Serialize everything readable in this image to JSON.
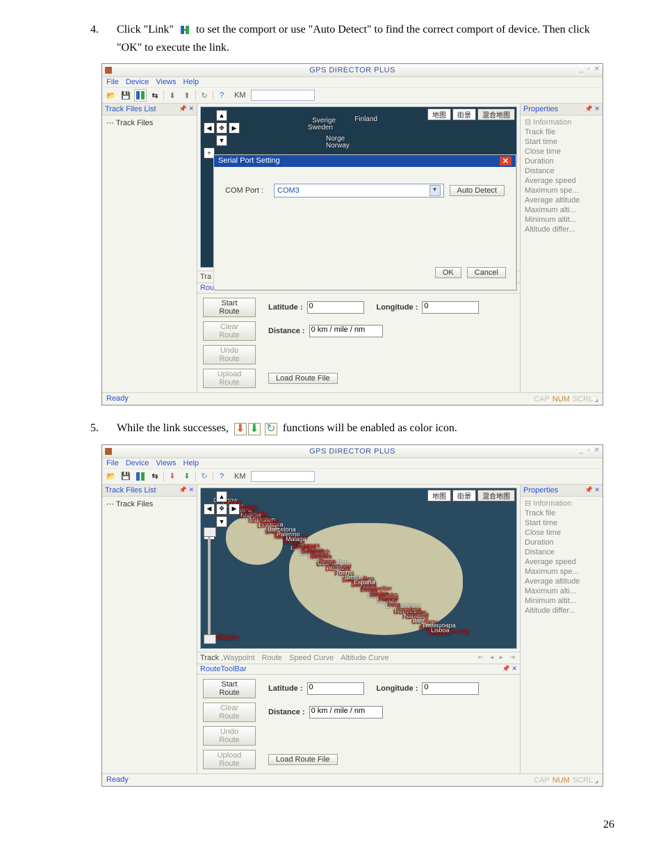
{
  "steps": {
    "s4_num": "4.",
    "s4_text_a": "Click \"Link\"",
    "s4_text_b": "to set the comport or use \"Auto Detect\" to find the correct comport of device. Then click \"OK\" to execute the link.",
    "s5_num": "5.",
    "s5_text_a": "While the link successes,",
    "s5_text_b": "functions will be enabled as color icon."
  },
  "app_title": "GPS DIRECTOR PLUS",
  "menu": [
    "File",
    "Device",
    "Views",
    "Help"
  ],
  "toolbar_unit": "KM",
  "left_panel_title": "Track Files List",
  "tree_root": "Track Files",
  "properties_title": "Properties",
  "prop_section": "Information",
  "props": [
    "Track file",
    "Start time",
    "Close time",
    "Duration",
    "Distance",
    "Average speed",
    "Maximum spe...",
    "Average altitude",
    "Maximum alti...",
    "Minimum altit...",
    "Altitude differ..."
  ],
  "map_tabs": [
    "地图",
    "街景",
    "混合地图"
  ],
  "map1_labels": {
    "norge": "Norge",
    "norway": "Norway",
    "sverige": "Sverige",
    "sweden": "Sweden",
    "finland": "Finland"
  },
  "dialog": {
    "title": "Serial Port Setting",
    "comport": "COM Port :",
    "comport_value": "COM3",
    "autodetect": "Auto Detect",
    "ok": "OK",
    "cancel": "Cancel"
  },
  "tabs2": {
    "track": "Track",
    "wp": ",Waypoint",
    "route": "Route",
    "speed": "Speed Curve",
    "alt": "Altitude Curve",
    "prefix": "Tra",
    "line2": "Rou"
  },
  "route_toolbar": "RouteToolBar",
  "route": {
    "start": "Start Route",
    "clear": "Clear Route",
    "undo": "Undo Route",
    "upload": "Upload Route",
    "load": "Load Route File",
    "lat": "Latitude :",
    "lon": "Longitude :",
    "dist": "Distance :",
    "zero": "0",
    "dvalue": "0 km / mile / nm"
  },
  "status": {
    "ready": "Ready",
    "cap": "CAP",
    "num": "NUM",
    "scrl": "SCRL"
  },
  "page_no": "26",
  "map2_labels": [
    "Glasgow",
    "Edinburgh",
    "United",
    "Kingdom",
    "Belfast",
    "Liverpool",
    "Ireland",
    "Manchester",
    "Birmingham",
    "London",
    "Nederland",
    "Netherlands",
    "Eindhoven",
    "Danmark",
    "Denmark",
    "Malmö",
    "Hamburg",
    "Bremen",
    "Lietuva",
    "Lithuania",
    "Gdańsk",
    "Polska",
    "Poland",
    "Essen",
    "Deutschland",
    "Germany",
    "Wrocław",
    "Kraków",
    "België",
    "Belgique",
    "Česká Rep.",
    "Czech Rep.",
    "Slovensko",
    "Rennes",
    "Paris",
    "Reims",
    "München",
    "Wien",
    "Österreich",
    "Austria",
    "Slovenia",
    "France",
    "Nantes",
    "Magyarország",
    "Hungary",
    "Hrvatska",
    "Croatia",
    "Genova",
    "Torino",
    "Montpellier",
    "Italia",
    "Italy",
    "Napoli",
    "Marseille",
    "Barcelona",
    "Zaragoza",
    "Roma",
    "Srbija",
    "Serbia",
    "România",
    "Тимишоара",
    "Ελλάς",
    "Greece",
    "Palermo",
    "Catania",
    "Portugal",
    "España",
    "Madrid",
    "Valencia",
    "Lisboa",
    "Cordoba",
    "Sevilla",
    "Malaga",
    "Bilbao"
  ]
}
